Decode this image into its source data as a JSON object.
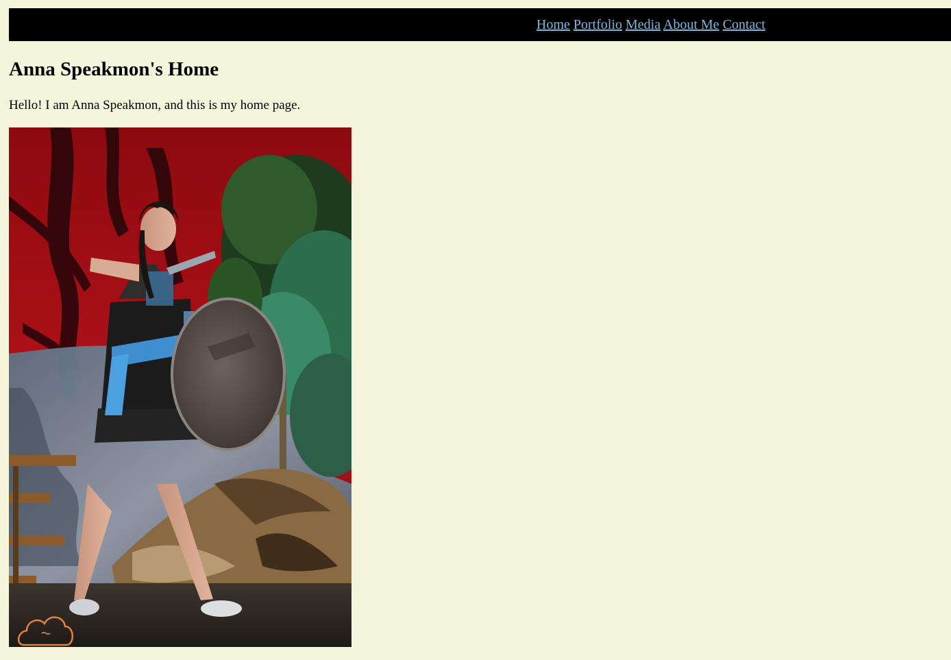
{
  "nav": {
    "items": [
      {
        "label": "Home"
      },
      {
        "label": "Portfolio"
      },
      {
        "label": "Media"
      },
      {
        "label": "About Me"
      },
      {
        "label": "Contact"
      }
    ]
  },
  "main": {
    "title": "Anna Speakmon's Home",
    "intro": "Hello! I am Anna Speakmon, and this is my home page.",
    "photo": {
      "icon": "cloud-watermark-icon"
    }
  },
  "colors": {
    "page_background": "#f5f5dc",
    "nav_background": "#000000",
    "link": "#7ab8e0",
    "watermark": "#e0823a"
  }
}
